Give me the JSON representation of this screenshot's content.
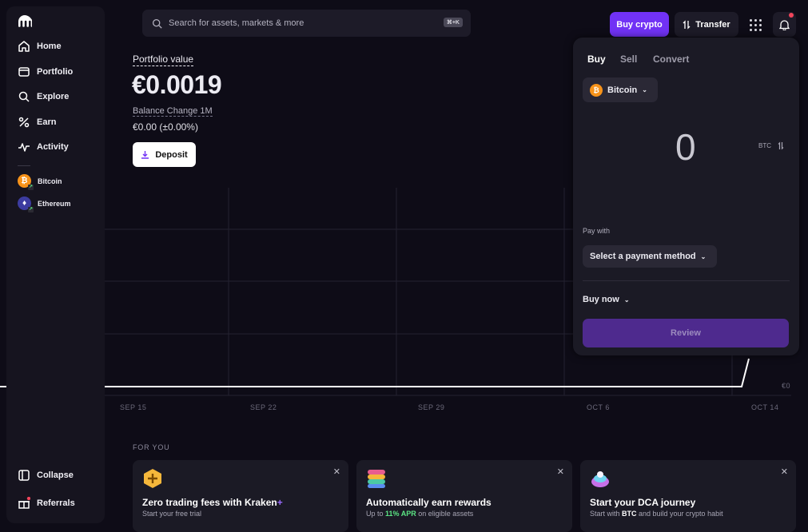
{
  "sidebar": {
    "nav": [
      "Home",
      "Portfolio",
      "Explore",
      "Earn",
      "Activity"
    ],
    "assets": [
      {
        "name": "Bitcoin",
        "symbol": "₿",
        "color": "#f7931a"
      },
      {
        "name": "Ethereum",
        "symbol": "♦",
        "color": "#3c3ca0"
      }
    ],
    "collapse": "Collapse",
    "referrals": "Referrals"
  },
  "search": {
    "placeholder": "Search for assets, markets & more",
    "shortcut": "⌘+K"
  },
  "header": {
    "buy_crypto": "Buy crypto",
    "transfer": "Transfer"
  },
  "portfolio": {
    "label": "Portfolio value",
    "value": "€0.0019",
    "change_label": "Balance Change 1M",
    "change_value": "€0.00 (±0.00%)",
    "deposit": "Deposit"
  },
  "chart": {
    "x_ticks": [
      "SEP 15",
      "SEP 22",
      "SEP 29",
      "OCT 6",
      "OCT 14"
    ],
    "y_label": "€0"
  },
  "trade_panel": {
    "tabs": [
      "Buy",
      "Sell",
      "Convert"
    ],
    "active_tab": "Buy",
    "asset": "Bitcoin",
    "amount": "0",
    "unit": "BTC",
    "pay_label": "Pay with",
    "pay_select": "Select a payment method",
    "buy_now": "Buy now",
    "review": "Review"
  },
  "for_you": {
    "label": "FOR YOU",
    "cards": [
      {
        "title": "Zero trading fees with Kraken",
        "title_suffix": "+",
        "subtitle": "Start your free trial"
      },
      {
        "title": "Automatically earn rewards",
        "sub_pre": "Up to ",
        "sub_highlight": "11% APR",
        "sub_post": " on eligible assets"
      },
      {
        "title": "Start your DCA journey",
        "sub_pre": "Start with ",
        "sub_highlight": "BTC",
        "sub_post": " and build your crypto habit"
      }
    ]
  },
  "colors": {
    "accent": "#7132f5",
    "bg": "#0e0c17",
    "panel": "#1b1a25",
    "positive": "#5be584"
  }
}
